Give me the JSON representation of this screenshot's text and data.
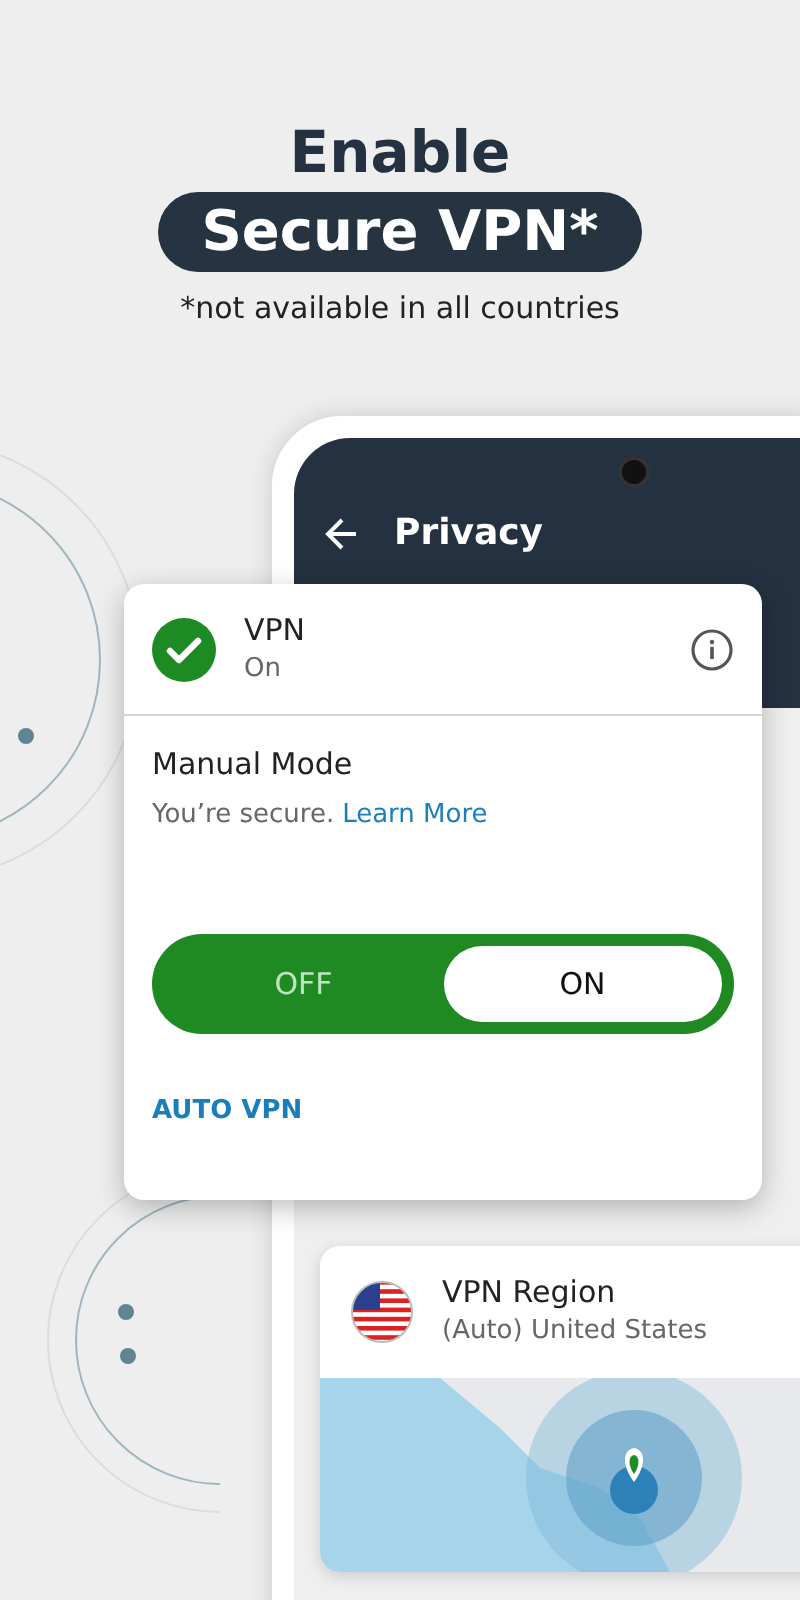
{
  "headline": {
    "line1": "Enable",
    "highlight": "Secure VPN*",
    "footnote": "*not available in all countries"
  },
  "app": {
    "title": "Privacy"
  },
  "vpn_card": {
    "title": "VPN",
    "status": "On",
    "enabled": true,
    "mode_title": "Manual Mode",
    "mode_text": "You’re secure.",
    "link": "Learn More",
    "toggle": [
      {
        "label": "OFF",
        "selected": false
      },
      {
        "label": "ON",
        "selected": true
      }
    ],
    "auto_link": "AUTO VPN"
  },
  "region_card": {
    "title": "VPN Region",
    "value": "(Auto) United States"
  }
}
